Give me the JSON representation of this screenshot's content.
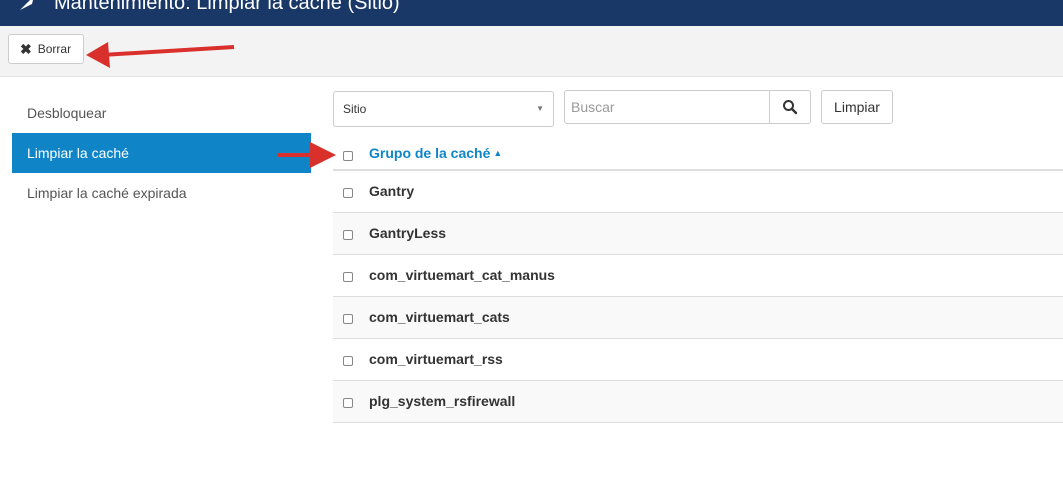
{
  "header": {
    "title": "Mantenimiento: Limpiar la caché (Sitio)"
  },
  "toolbar": {
    "delete_label": "Borrar"
  },
  "sidebar": {
    "items": [
      {
        "label": "Desbloquear"
      },
      {
        "label": "Limpiar la caché"
      },
      {
        "label": "Limpiar la caché expirada"
      }
    ]
  },
  "filters": {
    "client_selected": "Sitio",
    "search_placeholder": "Buscar",
    "clear_label": "Limpiar"
  },
  "table": {
    "header_label": "Grupo de la caché",
    "rows": [
      {
        "name": "Gantry"
      },
      {
        "name": "GantryLess"
      },
      {
        "name": "com_virtuemart_cat_manus"
      },
      {
        "name": "com_virtuemart_cats"
      },
      {
        "name": "com_virtuemart_rss"
      },
      {
        "name": "plg_system_rsfirewall"
      }
    ]
  },
  "colors": {
    "header_bg": "#1a3867",
    "active_item_bg": "#0f85c8",
    "link_color": "#0f85c8",
    "annotation_arrow": "#d9302c"
  }
}
